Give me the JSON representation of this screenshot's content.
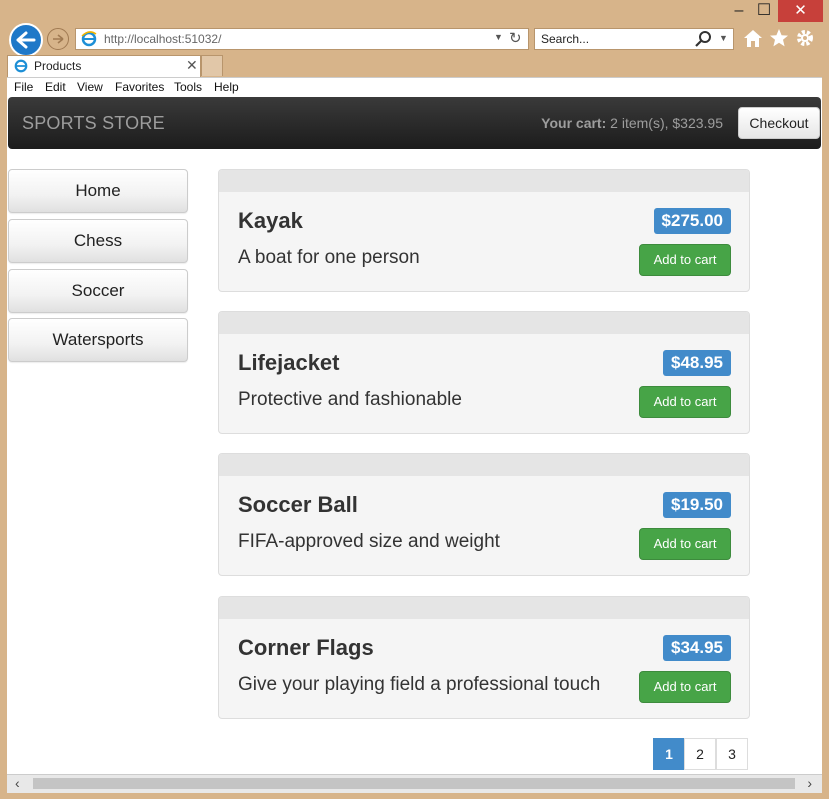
{
  "window": {
    "min": "–",
    "max": "☐",
    "close": "✕"
  },
  "browser": {
    "address": "http://localhost:51032/",
    "search_placeholder": "Search...",
    "tab_title": "Products",
    "tab_close": "✕",
    "menu": [
      "File",
      "Edit",
      "View",
      "Favorites",
      "Tools",
      "Help"
    ]
  },
  "navbar": {
    "brand": "SPORTS STORE",
    "cart_label": "Your cart:",
    "cart_summary": "2 item(s), $323.95",
    "checkout": "Checkout"
  },
  "categories": [
    "Home",
    "Chess",
    "Soccer",
    "Watersports"
  ],
  "products": [
    {
      "name": "Kayak",
      "description": "A boat for one person",
      "price": "$275.00",
      "button": "Add to cart"
    },
    {
      "name": "Lifejacket",
      "description": "Protective and fashionable",
      "price": "$48.95",
      "button": "Add to cart"
    },
    {
      "name": "Soccer Ball",
      "description": "FIFA-approved size and weight",
      "price": "$19.50",
      "button": "Add to cart"
    },
    {
      "name": "Corner Flags",
      "description": "Give your playing field a professional touch",
      "price": "$34.95",
      "button": "Add to cart"
    }
  ],
  "pagination": {
    "pages": [
      "1",
      "2",
      "3"
    ],
    "active": "1"
  },
  "scrollbar": {
    "left": "‹",
    "right": "›"
  },
  "colors": {
    "price_badge": "#428bca",
    "add_button": "#47a447",
    "navbar": "#222222"
  }
}
